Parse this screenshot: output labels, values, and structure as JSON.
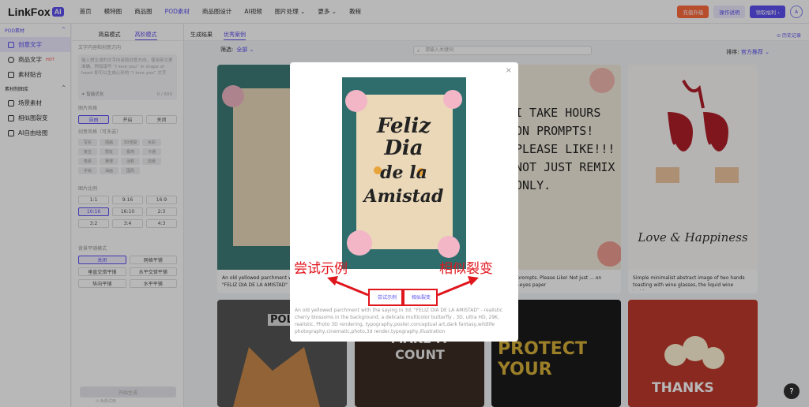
{
  "brand": {
    "name": "LinkFox",
    "badge": "AI",
    "color": "#5b50f0"
  },
  "nav": [
    "首页",
    "模特图",
    "商品图",
    "POD素材",
    "商品图设计",
    "AI视频",
    "图片处理 ⌄",
    "更多 ⌄",
    "教程"
  ],
  "nav_active": 3,
  "top_actions": {
    "btn1": "充值升级",
    "btn2": "操作说明",
    "btn3": "领取福利 ›",
    "avatar": "A"
  },
  "sidebar": {
    "sec1": "POD素材",
    "items1": [
      {
        "label": "创意文字",
        "icon": "text-icon",
        "active": true
      },
      {
        "label": "商品文字",
        "icon": "circle-icon",
        "hot": "HOT"
      },
      {
        "label": "素材贴合",
        "icon": "fit-icon"
      }
    ],
    "sec2": "素材制图库",
    "items2": [
      {
        "label": "场景素材",
        "icon": "scene-icon"
      },
      {
        "label": "相似图裂变",
        "icon": "split-icon"
      },
      {
        "label": "AI自由绘图",
        "icon": "draw-icon"
      }
    ]
  },
  "panel": {
    "tab1": "简易模式",
    "tab2": "高阶模式",
    "label1": "文字内容和创意方向",
    "placeholder": "输入想生成的文字内容和创意方向。使用英文更准确。例如填写 “I love you” in shape of heart 即可以生成心形的 “I love you” 文字",
    "count": "0 / 600",
    "wand": "✦ 智能优化",
    "label2": "图片风格",
    "style_opts": [
      "自由",
      "开启",
      "关闭"
    ],
    "label3": "创意风格（可多选）",
    "chips": [
      "写实",
      "插画",
      "3D渲染",
      "水彩",
      "复古",
      "霓虹",
      "极简",
      "卡通",
      "像素",
      "赛博",
      "涂鸦",
      "剪纸",
      "手绘",
      "油画",
      "国风"
    ],
    "label4": "图片比例",
    "ratios": [
      "1:1",
      "9:16",
      "16:9",
      "10:16",
      "16:10",
      "2:3",
      "3:2",
      "3:4",
      "4:3"
    ],
    "ratio_selected": "10:16",
    "label5": "背景平铺模式",
    "tile_opts": [
      "关闭",
      "网格平铺",
      "垂直交错平铺",
      "水平交错平铺",
      "纵向平铺",
      "水平平铺"
    ],
    "generate": "开始生成",
    "footnote": "⊙ 免费试用"
  },
  "main": {
    "tab1": "生成结果",
    "tab2": "优秀案例",
    "history": "⊙ 历史记录",
    "filter_label": "筛选:",
    "filter_value": "全部 ⌄",
    "search_placeholder": "请输入关键词",
    "sort_label": "排序:",
    "sort_value": "官方推荐 ⌄"
  },
  "cards": {
    "c1_caption": "An old yellowed parchment with the saying in 3d: \"FELIZ DIA DE LA AMISTAD\"",
    "c2_caption": "...urs on prompts. Please Like! Not just ... on catching -eyes paper",
    "c3_caption": "Simple minimalist abstract image of two hands toasting with wine glasses, the liquid wine inside...",
    "c2_text": "I TAKE HOURS ON PROMPTS! PLEASE LIKE!!! NOT JUST REMIX ONLY.",
    "c3_text": "Love & Happiness",
    "c4_text": "POLI",
    "c5_text": "MAKE IT COUNT",
    "c6_text": "PROTECT YOUR",
    "c7_text": "THANKS"
  },
  "modal": {
    "image_text": [
      "Feliz",
      "Dia",
      "de la",
      "Amistad"
    ],
    "try_btn": "尝试示例",
    "similar_btn": "相似裂变",
    "desc": "An old yellowed parchment with the saying in 3d: \"FELIZ DIA DE LA AMISTAD\" - realistic cherry blossoms in the background, a delicate multicolor butterfly , 3D, ultra HD, 29K, realistic, Photo 3D rendering, typography,poster,conceptual art,dark fantasy,wildlife photography,cinematic,photo,3d render,typography,illustration",
    "close": "×"
  },
  "annotations": {
    "left": "尝试示例",
    "right": "相似裂变",
    "color": "#e0161d"
  },
  "help": "?"
}
